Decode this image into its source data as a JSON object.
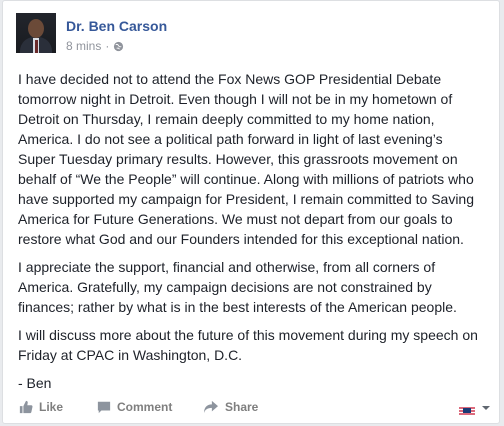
{
  "post": {
    "author": "Dr. Ben Carson",
    "time": "8 mins",
    "separator": "·",
    "paragraphs": [
      [
        "I have decided not to attend the Fox News GOP Presidential Debate",
        "tomorrow night in Detroit. Even though I will not be in my hometown of",
        "Detroit on Thursday, I remain deeply committed to my home nation,",
        "America. I do not see a political path forward in light of last evening’s",
        "Super Tuesday primary results. However, this grassroots movement on",
        "behalf of “We the People” will continue. Along with millions of patriots who",
        "have supported my campaign for President, I remain committed to Saving",
        "America for Future Generations. We must not depart from our goals to",
        "restore what God and our Founders intended for this exceptional nation."
      ],
      [
        "I appreciate the support, financial and otherwise, from all corners of",
        "America. Gratefully, my campaign decisions are not constrained by",
        "finances; rather by what is in the best interests of the American people."
      ],
      [
        "I will discuss more about the future of this movement during my speech on",
        "Friday at CPAC in Washington, D.C."
      ],
      [
        "- Ben"
      ]
    ]
  },
  "actions": {
    "like": "Like",
    "comment": "Comment",
    "share": "Share"
  },
  "icons": {
    "avatar": "profile-photo",
    "audience": "globe-icon",
    "like": "thumbs-up-icon",
    "comment": "speech-bubble-icon",
    "share": "share-arrow-icon",
    "page_avatar": "page-logo-icon",
    "menu": "caret-down-icon"
  },
  "colors": {
    "author_link": "#365899",
    "body_text": "#1d2129",
    "meta_text": "#90949c",
    "action_text": "#7f7f7f",
    "background": "#e9ebee"
  }
}
